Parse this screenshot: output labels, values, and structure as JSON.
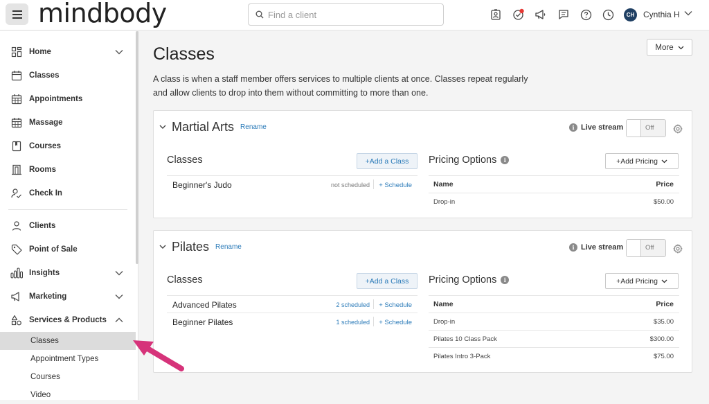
{
  "header": {
    "logo": "mindbody",
    "search_placeholder": "Find a client",
    "user_initials": "CH",
    "user_name": "Cynthia H"
  },
  "sidebar": {
    "items": [
      {
        "label": "Home",
        "icon": "dashboard-icon",
        "expandable": true
      },
      {
        "label": "Classes",
        "icon": "calendar-icon"
      },
      {
        "label": "Appointments",
        "icon": "calendar-grid-icon"
      },
      {
        "label": "Massage",
        "icon": "calendar-grid-icon"
      },
      {
        "label": "Courses",
        "icon": "bookmark-icon"
      },
      {
        "label": "Rooms",
        "icon": "door-icon"
      },
      {
        "label": "Check In",
        "icon": "person-check-icon"
      },
      {
        "label": "Clients",
        "icon": "person-icon"
      },
      {
        "label": "Point of Sale",
        "icon": "tag-icon"
      },
      {
        "label": "Insights",
        "icon": "bar-chart-icon",
        "expandable": true
      },
      {
        "label": "Marketing",
        "icon": "megaphone-icon",
        "expandable": true
      },
      {
        "label": "Services & Products",
        "icon": "shapes-icon",
        "expandable": true,
        "expanded": true
      }
    ],
    "sub_items": [
      {
        "label": "Classes",
        "active": true
      },
      {
        "label": "Appointment Types"
      },
      {
        "label": "Courses"
      },
      {
        "label": "Video"
      }
    ]
  },
  "main": {
    "title": "Classes",
    "more_label": "More",
    "description": "A class is when a staff member offers services to multiple clients at once. Classes repeat regularly and allow clients to drop into them without committing to more than one.",
    "categories": [
      {
        "name": "Martial Arts",
        "rename_label": "Rename",
        "livestream_label": "Live stream",
        "toggle_label": "Off",
        "classes_title": "Classes",
        "add_class_label": "+Add a Class",
        "classes": [
          {
            "name": "Beginner's Judo",
            "status": "not scheduled",
            "schedule_label": "+ Schedule"
          }
        ],
        "pricing_title": "Pricing Options",
        "add_pricing_label": "+Add Pricing",
        "pricing_header": {
          "name": "Name",
          "price": "Price"
        },
        "pricing": [
          {
            "name": "Drop-in",
            "price": "$50.00"
          }
        ]
      },
      {
        "name": "Pilates",
        "rename_label": "Rename",
        "livestream_label": "Live stream",
        "toggle_label": "Off",
        "classes_title": "Classes",
        "add_class_label": "+Add a Class",
        "classes": [
          {
            "name": "Advanced Pilates",
            "status": "2 scheduled",
            "schedule_label": "+ Schedule"
          },
          {
            "name": "Beginner Pilates",
            "status": "1 scheduled",
            "schedule_label": "+ Schedule"
          }
        ],
        "pricing_title": "Pricing Options",
        "add_pricing_label": "+Add Pricing",
        "pricing_header": {
          "name": "Name",
          "price": "Price"
        },
        "pricing": [
          {
            "name": "Drop-in",
            "price": "$35.00"
          },
          {
            "name": "Pilates 10 Class Pack",
            "price": "$300.00"
          },
          {
            "name": "Pilates Intro 3-Pack",
            "price": "$75.00"
          }
        ]
      }
    ]
  },
  "colors": {
    "link": "#2a7ab8",
    "notification_dot": "#e53935",
    "arrow": "#d6337a",
    "avatar_bg": "#1f3f63"
  }
}
